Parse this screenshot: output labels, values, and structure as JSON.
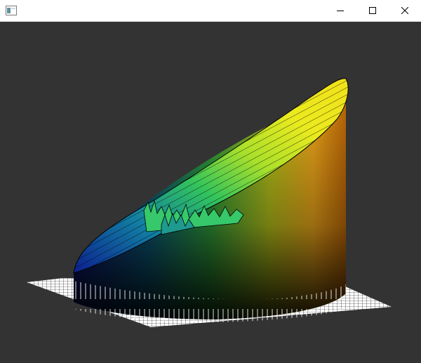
{
  "window": {
    "title": "",
    "buttons": [
      "minimize",
      "maximize",
      "close"
    ],
    "icons": [
      "app-icon",
      "minimize-icon",
      "maximize-icon",
      "close-icon"
    ]
  },
  "viewport": {
    "background_color": "#333333",
    "content": "3d-surface-plot",
    "colormap": [
      "#0a1f8a",
      "#1a7fb0",
      "#2fc26a",
      "#b7e321",
      "#f2e91c",
      "#f39a0f",
      "#000000"
    ],
    "wireframe_color": "#000000",
    "base_grid_color": "#ffffff"
  }
}
